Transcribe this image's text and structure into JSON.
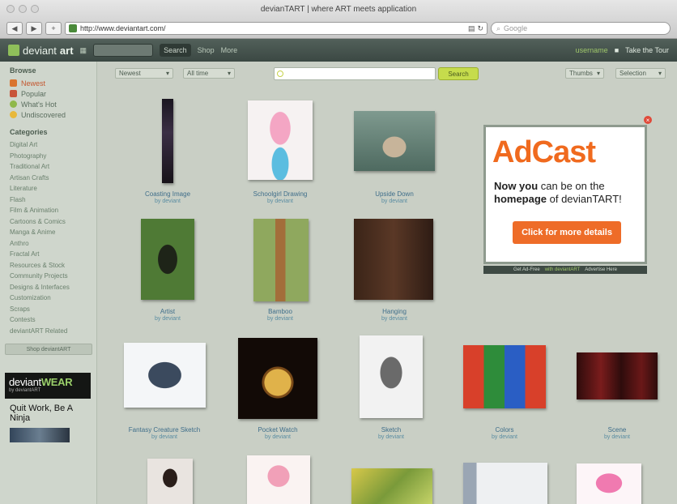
{
  "browser": {
    "window_title": "devianTART | where ART meets application",
    "url": "http://www.deviantart.com/",
    "search_placeholder": "Google"
  },
  "site": {
    "logo_text": "deviant",
    "logo_bold": "art",
    "header_buttons": [
      "Search",
      "Shop",
      "More"
    ],
    "user_link": "username",
    "submit_label": "Take the Tour"
  },
  "sidebar": {
    "browse_heading": "Browse",
    "browse_items": [
      {
        "label": "Newest",
        "icon": "newest-icon",
        "color": "#d9742e",
        "active": true
      },
      {
        "label": "Popular",
        "icon": "popular-icon",
        "color": "#c8553a",
        "active": false
      },
      {
        "label": "What's Hot",
        "icon": "hot-icon",
        "color": "#8fb84a",
        "active": false
      },
      {
        "label": "Undiscovered",
        "icon": "undiscovered-icon",
        "color": "#e8b83a",
        "active": false
      }
    ],
    "categories_heading": "Categories",
    "categories": [
      "Digital Art",
      "Photography",
      "Traditional Art",
      "Artisan Crafts",
      "Literature",
      "Flash",
      "Film & Animation",
      "Cartoons & Comics",
      "Manga & Anime",
      "Anthro",
      "Fractal Art",
      "Resources & Stock",
      "Community Projects",
      "Designs & Interfaces",
      "Customization",
      "Scraps",
      "Contests",
      "deviantART Related"
    ],
    "shop_button": "Shop deviantART",
    "promo_title": "deviant",
    "promo_bold": "WEAR",
    "promo_sub": "by deviantART",
    "promo_text": "Quit Work, Be A Ninja"
  },
  "filters": {
    "sort": "Newest",
    "time": "All time",
    "search_button": "Search",
    "view": "Thumbs",
    "selection": "Selection"
  },
  "ad": {
    "brand": "AdCast",
    "line1_bold": "Now you",
    "line1_rest": " can be on the",
    "line2_bold": "homepage",
    "line2_rest": " of devianTART!",
    "cta": "Click for more details",
    "footer": [
      "Get Ad-Free",
      "with deviantART",
      "Advertise Here"
    ],
    "close": "×"
  },
  "thumbnails": [
    {
      "title": "Coasting Image",
      "by": "by deviant"
    },
    {
      "title": "Schoolgirl Drawing",
      "by": "by deviant"
    },
    {
      "title": "Upside Down",
      "by": "by deviant"
    },
    {
      "title": "Artist",
      "by": "by deviant"
    },
    {
      "title": "Bamboo",
      "by": "by deviant"
    },
    {
      "title": "Hanging",
      "by": "by deviant"
    },
    {
      "title": "Fantasy Creature Sketch",
      "by": "by deviant"
    },
    {
      "title": "Pocket Watch",
      "by": "by deviant"
    },
    {
      "title": "Sketch",
      "by": "by deviant"
    },
    {
      "title": "Colors",
      "by": "by deviant"
    },
    {
      "title": "Scene",
      "by": "by deviant"
    }
  ]
}
